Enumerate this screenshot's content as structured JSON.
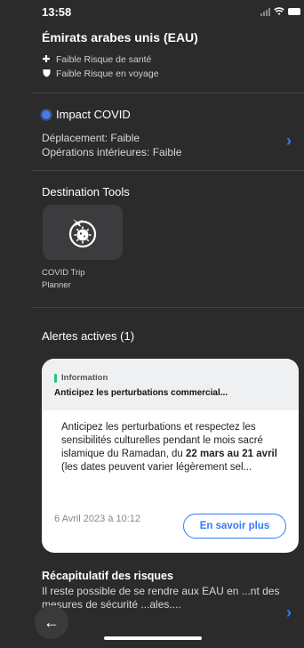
{
  "status_bar": {
    "time": "13:58"
  },
  "country": {
    "name": "Émirats arabes unis (EAU)",
    "health_risk": "Faible Risque de santé",
    "travel_risk": "Faible Risque en voyage"
  },
  "covid": {
    "title": "Impact COVID",
    "travel": "Déplacement: Faible",
    "domestic": "Opérations intérieures: Faible"
  },
  "tools": {
    "title": "Destination Tools",
    "items": [
      {
        "label": "COVID Trip Planner"
      }
    ]
  },
  "alerts": {
    "title": "Alertes actives (1)",
    "card": {
      "category": "Information",
      "headline": "Anticipez les perturbations commercial...",
      "body_part1": "Anticipez les perturbations et respectez les sensibilités culturelles pendant le mois sacré islamique du Ramadan, du ",
      "body_bold": "22 mars au 21 avril",
      "body_part2": " (les dates peuvent varier légèrement sel...",
      "date": "6 Avril 2023 à 10:12",
      "button": "En savoir plus"
    }
  },
  "recap": {
    "title": "Récapitulatif des risques",
    "text": "Il reste possible de se rendre aux EAU en ...nt des mesures de sécurité ...ales...."
  },
  "colors": {
    "accent": "#2f7df6",
    "info": "#2fc07a",
    "background": "#2b2b2b"
  }
}
